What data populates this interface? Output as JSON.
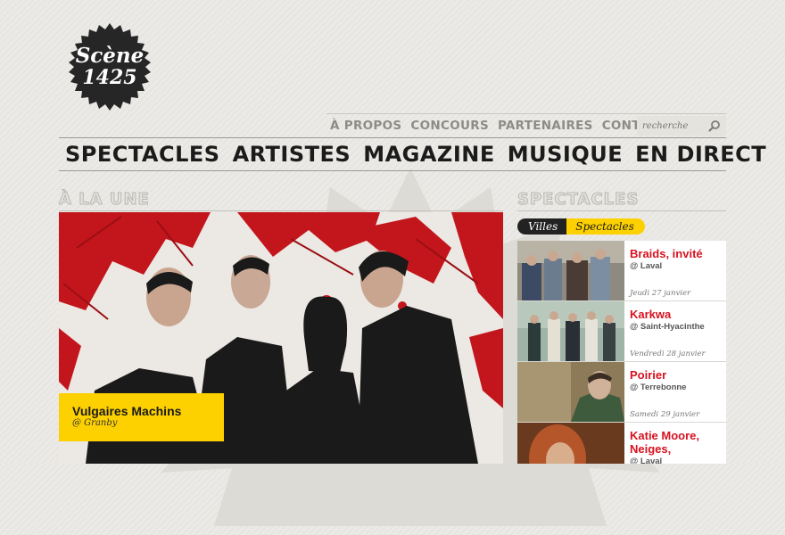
{
  "brand": {
    "line1": "Scène",
    "line2": "1425"
  },
  "top_nav": {
    "items": [
      "À PROPOS",
      "CONCOURS",
      "PARTENAIRES",
      "CONTACT"
    ],
    "search_placeholder": "recherche"
  },
  "main_nav": {
    "items": [
      "SPECTACLES",
      "ARTISTES",
      "MAGAZINE",
      "MUSIQUE",
      "EN DIRECT"
    ]
  },
  "featured": {
    "section_title": "À LA UNE",
    "title": "Vulgaires Machins",
    "venue": "@ Granby"
  },
  "sidebar": {
    "section_title": "SPECTACLES",
    "tabs": [
      "Villes",
      "Spectacles"
    ],
    "events": [
      {
        "name": "Braids, invité",
        "city": "@ Laval",
        "date": "Jeudi 27 janvier"
      },
      {
        "name": "Karkwa",
        "city": "@ Saint-Hyacinthe",
        "date": "Vendredi 28 janvier"
      },
      {
        "name": "Poirier",
        "city": "@ Terrebonne",
        "date": "Samedi 29 janvier"
      },
      {
        "name": "Katie Moore, Neiges,",
        "city": "@ Laval",
        "date": ""
      }
    ]
  },
  "colors": {
    "accent_yellow": "#fdd100",
    "event_red": "#d7121f",
    "dark": "#222222"
  },
  "icons": {
    "search": "magnifier-icon"
  }
}
